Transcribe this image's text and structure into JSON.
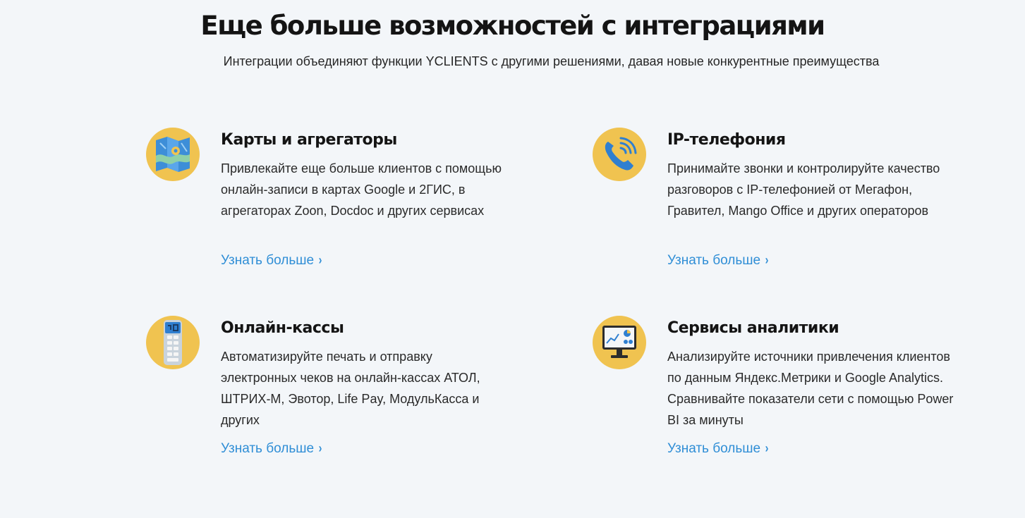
{
  "header": {
    "title": "Еще больше возможностей с интеграциями",
    "subtitle": "Интеграции объединяют функции YCLIENTS с другими решениями, давая новые конкурентные преимущества"
  },
  "colors": {
    "background": "#f3f6f9",
    "icon_circle": "#f0c350",
    "link": "#2f8ed6"
  },
  "cards": [
    {
      "icon": "map-icon",
      "title": "Карты и агрегаторы",
      "description": "Привлекайте еще больше клиентов с помощью онлайн-записи в картах Google и 2ГИС, в агрегаторах Zoon, Docdoc и других сервисах",
      "link": "Узнать больше"
    },
    {
      "icon": "phone-icon",
      "title": "IP-телефония",
      "description": "Принимайте звонки и контролируйте качество разговоров с IP-телефонией от Мегафон, Гравител, Mango Office и других операторов",
      "link": "Узнать больше"
    },
    {
      "icon": "payment-terminal-icon",
      "title": "Онлайн-кассы",
      "description": "Автоматизируйте печать и отправку электронных чеков на онлайн-кассах АТОЛ, ШТРИХ-М, Эвотор, Life Pay, МодульКасса и других",
      "link": "Узнать больше"
    },
    {
      "icon": "analytics-monitor-icon",
      "title": "Сервисы аналитики",
      "description": "Анализируйте источники привлечения клиентов по данным Яндекс.Метрики и Google Analytics. Сравнивайте показатели сети с помощью Power BI за минуты",
      "link": "Узнать больше"
    }
  ]
}
